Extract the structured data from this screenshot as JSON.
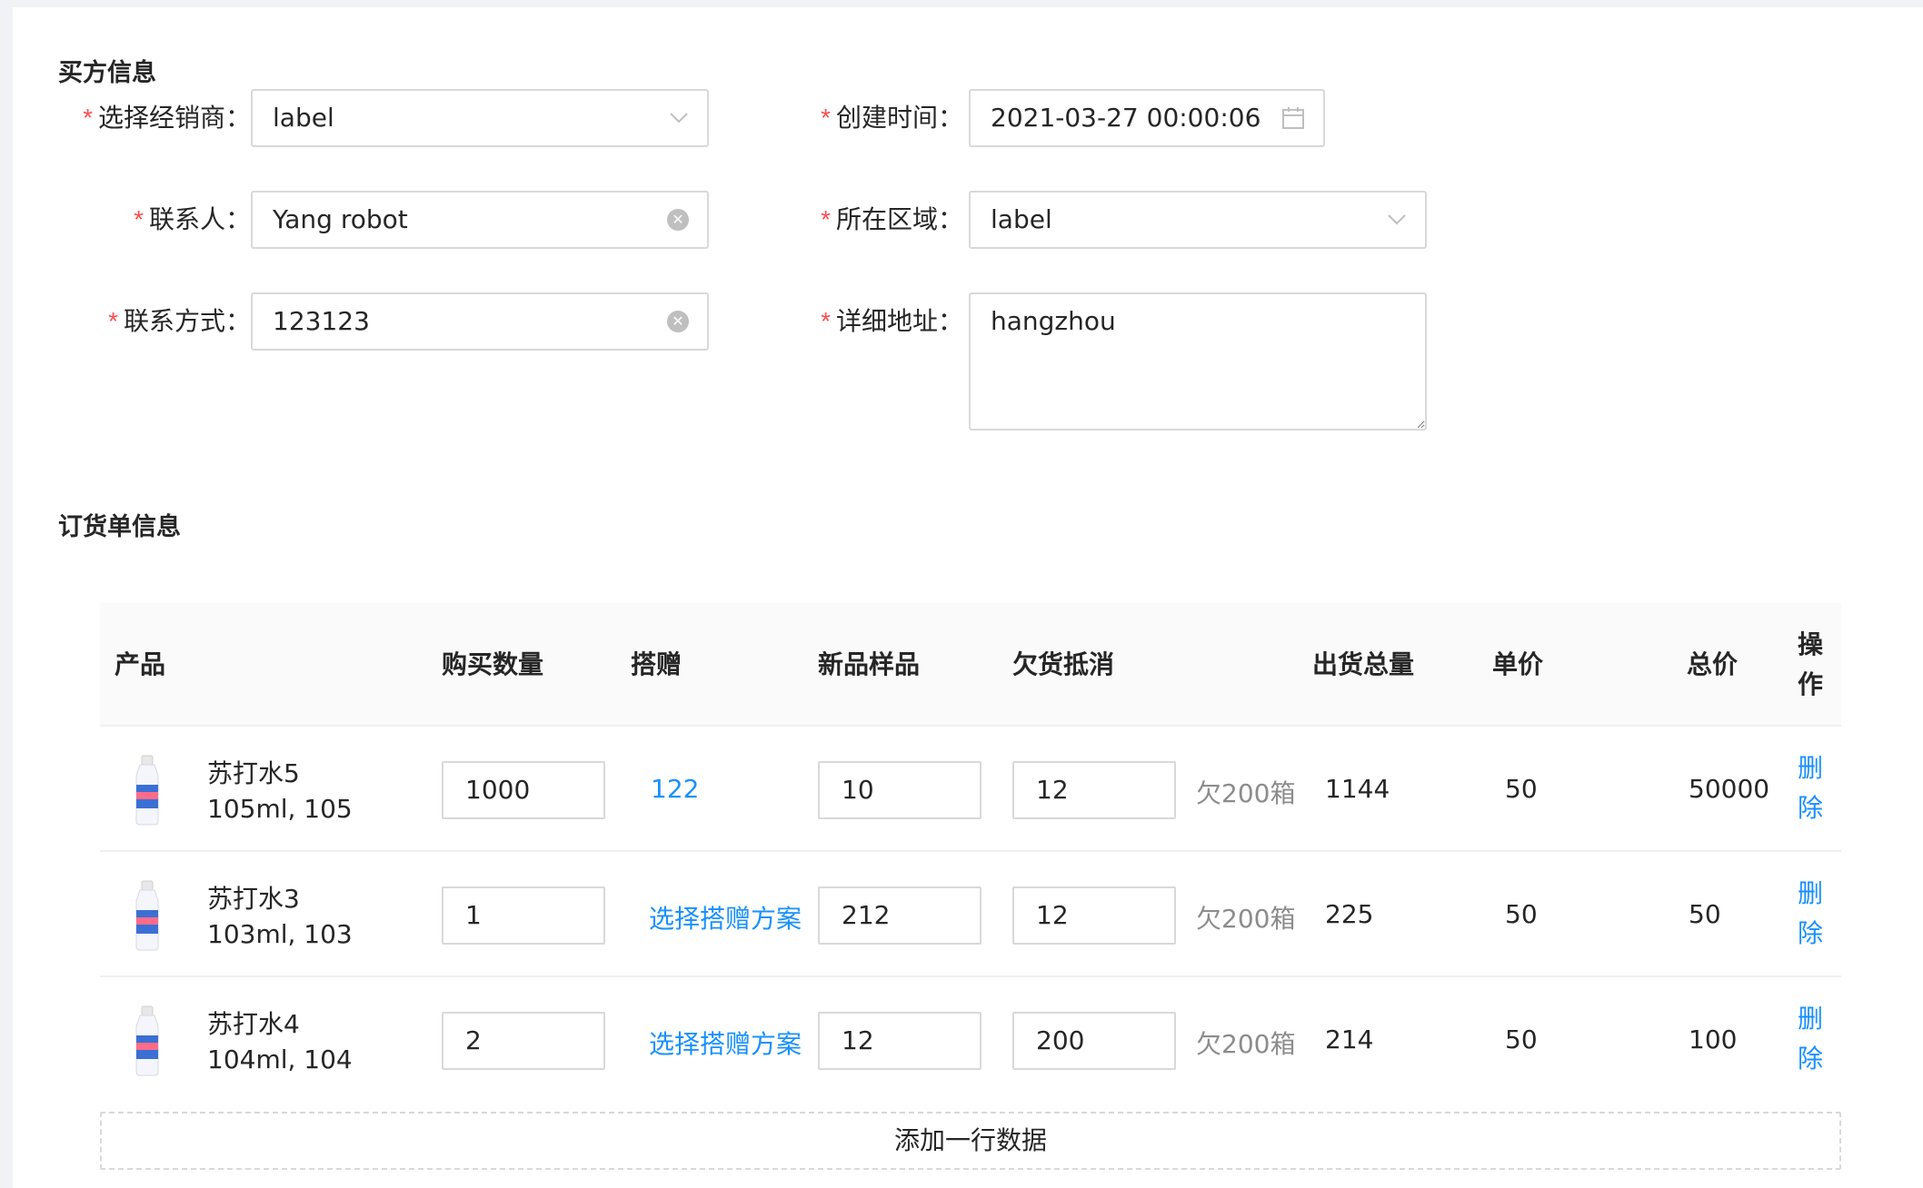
{
  "buyer": {
    "title": "买方信息",
    "dealer": {
      "label": "选择经销商：",
      "value": "label"
    },
    "contact": {
      "label": "联系人：",
      "value": "Yang robot"
    },
    "phone": {
      "label": "联系方式：",
      "value": "123123"
    },
    "created": {
      "label": "创建时间：",
      "value": "2021-03-27 00:00:06"
    },
    "region": {
      "label": "所在区域：",
      "value": "label"
    },
    "address": {
      "label": "详细地址：",
      "value": "hangzhou"
    }
  },
  "order": {
    "title": "订货单信息",
    "columns": [
      "产品",
      "购买数量",
      "搭赠",
      "新品样品",
      "欠货抵消",
      "出货总量",
      "单价",
      "总价",
      "操作"
    ],
    "rows": [
      {
        "name": "苏打水5",
        "spec": "105ml, 105",
        "qty": "1000",
        "gift": "122",
        "sample": "10",
        "offset": "12",
        "owed": "欠200箱",
        "total_qty": "1144",
        "unit_price": "50",
        "total_price": "50000",
        "action": "删除"
      },
      {
        "name": "苏打水3",
        "spec": "103ml, 103",
        "qty": "1",
        "gift": "选择搭赠方案",
        "sample": "212",
        "offset": "12",
        "owed": "欠200箱",
        "total_qty": "225",
        "unit_price": "50",
        "total_price": "50",
        "action": "删除"
      },
      {
        "name": "苏打水4",
        "spec": "104ml, 104",
        "qty": "2",
        "gift": "选择搭赠方案",
        "sample": "12",
        "offset": "200",
        "owed": "欠200箱",
        "total_qty": "214",
        "unit_price": "50",
        "total_price": "100",
        "action": "删除"
      }
    ],
    "add_row": "添加一行数据"
  },
  "colors": {
    "required": "#ff4d4f",
    "link": "#1890ff",
    "border": "#d9d9d9"
  },
  "icons": {
    "select": "chevron-down-icon",
    "clear": "close-circle-icon",
    "date": "calendar-icon"
  }
}
